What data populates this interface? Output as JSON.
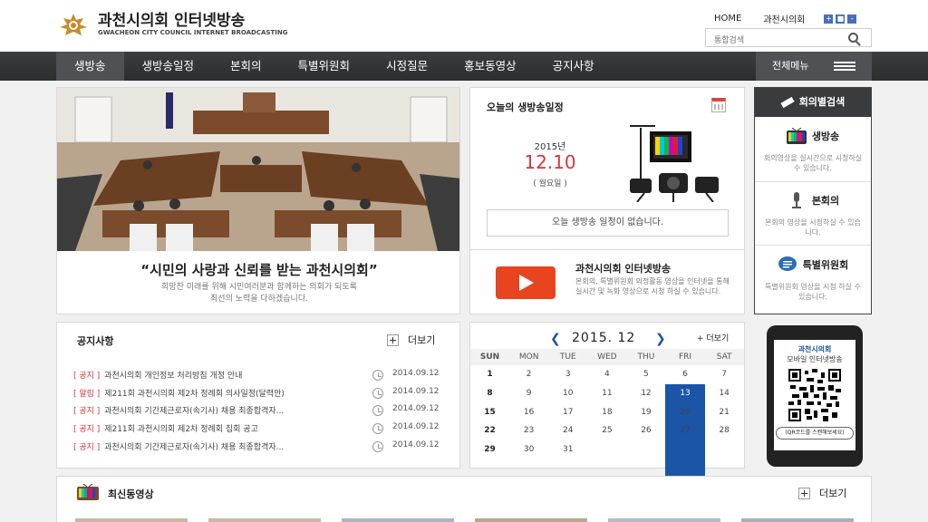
{
  "header": {
    "logo_main": "과천시의회 인터넷방송",
    "logo_sub": "GWACHEON CITY COUNCIL INTERNET BROADCASTING",
    "util_home": "HOME",
    "util_council": "과천시의회",
    "zoom_in": "+",
    "zoom_reset": "■",
    "zoom_out": "-",
    "search_placeholder": "통합검색"
  },
  "gnb": {
    "items": [
      "생방송",
      "생방송일정",
      "본회의",
      "특별위원회",
      "시정질문",
      "홍보동영상",
      "공지사항"
    ],
    "all_menu": "전체메뉴"
  },
  "hero": {
    "slogan": "“시민의 사랑과 신뢰를 받는 과천시의회”",
    "desc_line1": "희망찬 미래를 위해 시민여러분과 함께하는 의회가 되도록",
    "desc_line2": "최선의 노력을 다하겠습니다."
  },
  "today": {
    "title": "오늘의 생방송일정",
    "year": "2015년",
    "month_day": "12.10",
    "weekday": "( 월요일 )",
    "no_schedule": "오늘 생방송 일정이 없습니다."
  },
  "intro": {
    "title": "과천시의회 인터넷방송",
    "desc": "본회의, 특별위원회 의정활동 영상을 인터넷을 통해 실시간 및 녹화 영상으로 시청 하실 수 있습니다."
  },
  "side": {
    "title": "회의별검색",
    "items": [
      {
        "label": "생방송",
        "desc": "회의영상을 실시간으로 시청하실 수 있습니다."
      },
      {
        "label": "본회의",
        "desc": "본회의 영상을 시청하실 수 있습니다."
      },
      {
        "label": "특별위원회",
        "desc": "특별위원회 영상을 시청 하실 수 있습니다."
      }
    ]
  },
  "notice": {
    "title": "공지사항",
    "more": "더보기",
    "rows": [
      {
        "tag": "[ 공지 ]",
        "title": "과천시의회 개인정보 처리방침 개정 안내",
        "date": "2014.09.12"
      },
      {
        "tag": "[ 알림 ]",
        "title": "제211회 과천시의회 제2차 정례회 의사일정(달력안)",
        "date": "2014.09.12"
      },
      {
        "tag": "[ 공지 ]",
        "title": "과천시의회 기간제근로자(속기사) 채용 최종합격자...",
        "date": "2014.09.12"
      },
      {
        "tag": "[ 공지 ]",
        "title": "제211회 과천시의회 제2차 정례회 집회 공고",
        "date": "2014.09.12"
      },
      {
        "tag": "[ 공지 ]",
        "title": "과천시의회 기간제근로자(속기사) 채용 최종합격자...",
        "date": "2014.09.12"
      }
    ]
  },
  "calendar": {
    "prev": "❮",
    "next": "❯",
    "month": "2015. 12",
    "more": "+ 더보기",
    "weekdays": [
      "SUN",
      "MON",
      "TUE",
      "WED",
      "THU",
      "FRI",
      "SAT"
    ],
    "weeks": [
      [
        "1",
        "2",
        "3",
        "4",
        "5",
        "6",
        "7"
      ],
      [
        "8",
        "9",
        "10",
        "11",
        "12",
        "13",
        "14"
      ],
      [
        "15",
        "16",
        "17",
        "18",
        "19",
        "20",
        "21"
      ],
      [
        "22",
        "23",
        "24",
        "25",
        "26",
        "27",
        "28"
      ],
      [
        "29",
        "30",
        "31",
        "",
        "",
        "",
        ""
      ]
    ],
    "selected": "13"
  },
  "mobile": {
    "title1": "과천시의회",
    "title2": "모바일 인터넷방송",
    "note": "(QR코드를 스캔해보세요)"
  },
  "videos": {
    "title": "최신동영상",
    "more": "더보기"
  },
  "colors": {
    "accent_blue": "#1a55a8",
    "accent_red": "#d9343a",
    "nav_dark": "#3c3d3f"
  }
}
